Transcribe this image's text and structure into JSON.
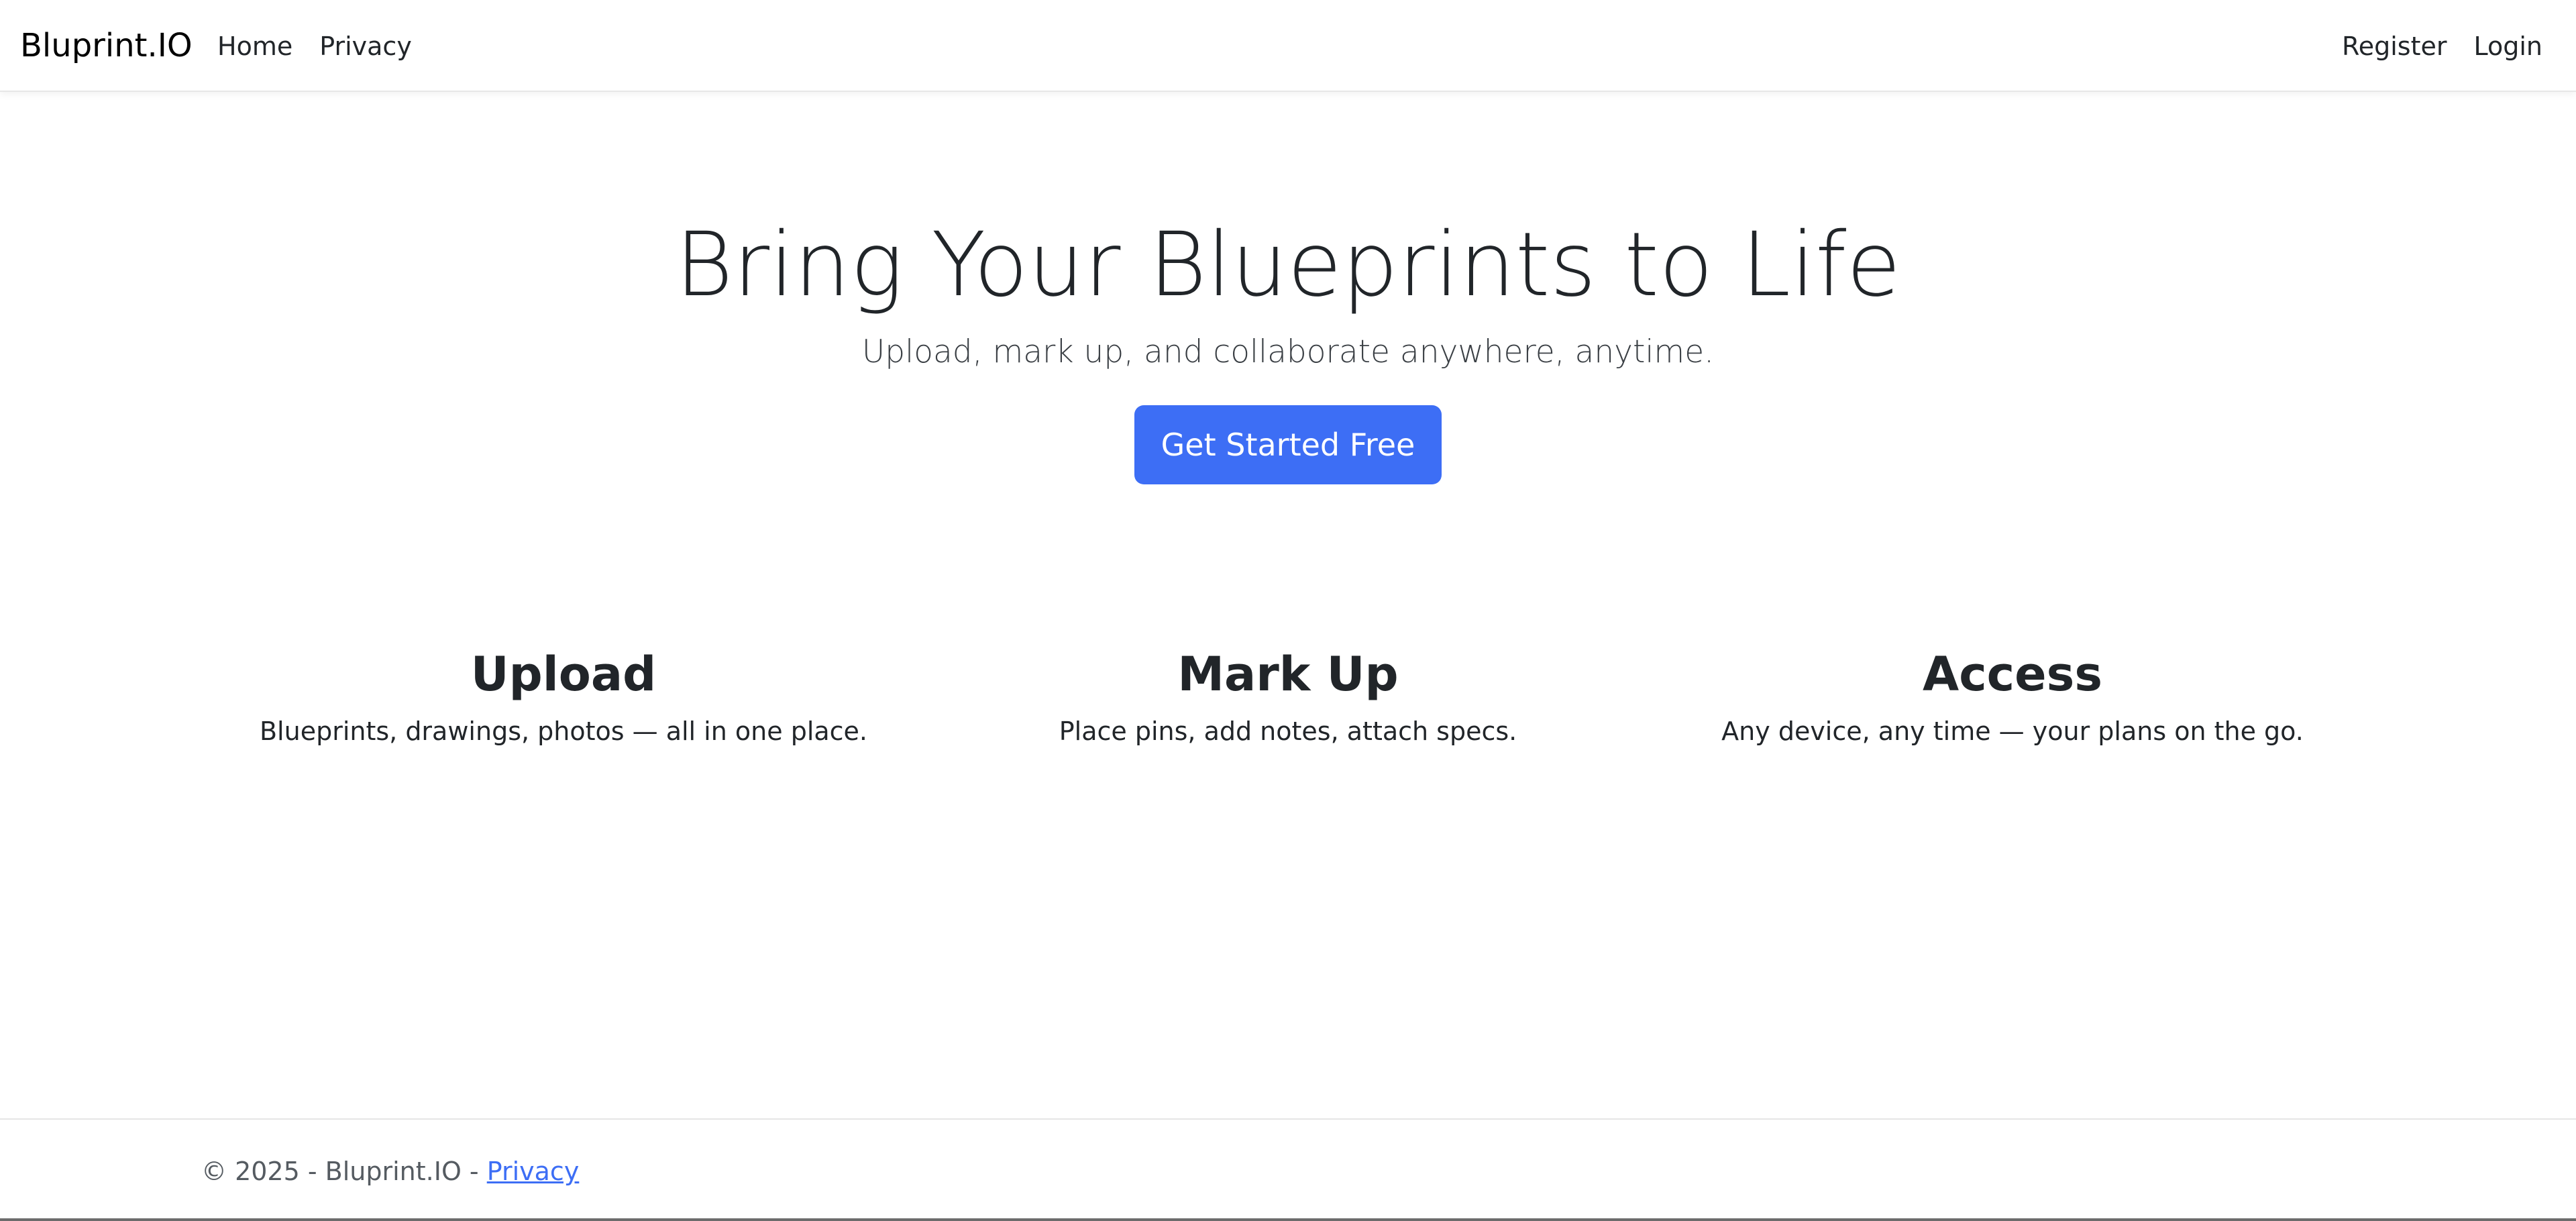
{
  "navbar": {
    "brand": "Bluprint.IO",
    "left_links": [
      "Home",
      "Privacy"
    ],
    "right_links": [
      "Register",
      "Login"
    ]
  },
  "hero": {
    "title": "Bring Your Blueprints to Life",
    "subtitle": "Upload, mark up, and collaborate anywhere, anytime.",
    "cta_label": "Get Started Free"
  },
  "features": [
    {
      "title": "Upload",
      "description": "Blueprints, drawings, photos — all in one place."
    },
    {
      "title": "Mark Up",
      "description": "Place pins, add notes, attach specs."
    },
    {
      "title": "Access",
      "description": "Any device, any time — your plans on the go."
    }
  ],
  "footer": {
    "copyright": "© 2025 - Bluprint.IO - ",
    "privacy_link": "Privacy"
  },
  "colors": {
    "accent": "#3d6ef5",
    "text": "#212529",
    "background": "#ffffff"
  }
}
